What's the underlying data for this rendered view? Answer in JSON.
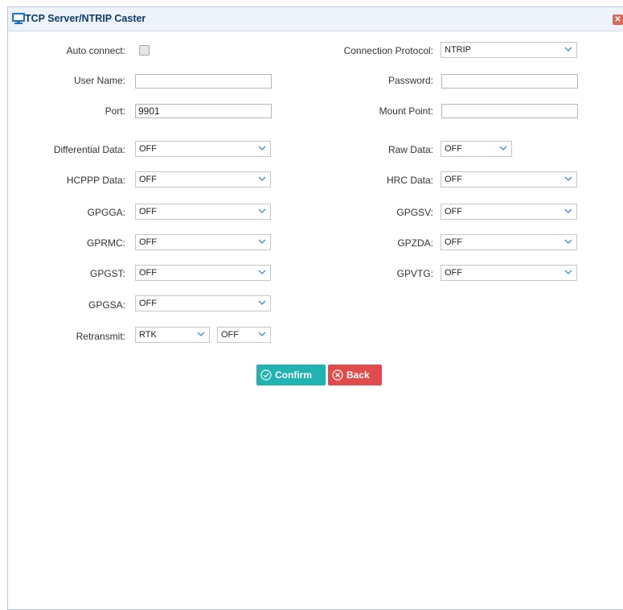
{
  "dialog": {
    "title": "TCP Server/NTRIP Caster",
    "close_icon_glyph": "✕"
  },
  "form": {
    "auto_connect_label": "Auto connect:",
    "auto_connect_checked": false,
    "connection_protocol_label": "Connection Protocol:",
    "connection_protocol_value": "NTRIP",
    "user_name_label": "User Name:",
    "user_name_value": "",
    "password_label": "Password:",
    "password_value": "",
    "port_label": "Port:",
    "port_value": "9901",
    "mount_point_label": "Mount Point:",
    "mount_point_value": "",
    "differential_data_label": "Differential Data:",
    "differential_data_value": "OFF",
    "raw_data_label": "Raw Data:",
    "raw_data_value": "OFF",
    "hcppp_data_label": "HCPPP Data:",
    "hcppp_data_value": "OFF",
    "hrc_data_label": "HRC Data:",
    "hrc_data_value": "OFF",
    "gpgga_label": "GPGGA:",
    "gpgga_value": "OFF",
    "gpgsv_label": "GPGSV:",
    "gpgsv_value": "OFF",
    "gprmc_label": "GPRMC:",
    "gprmc_value": "OFF",
    "gpzda_label": "GPZDA:",
    "gpzda_value": "OFF",
    "gpgst_label": "GPGST:",
    "gpgst_value": "OFF",
    "gpvtg_label": "GPVTG:",
    "gpvtg_value": "OFF",
    "gpgsa_label": "GPGSA:",
    "gpgsa_value": "OFF",
    "retransmit_label": "Retransmit:",
    "retransmit_type_value": "RTK",
    "retransmit_state_value": "OFF"
  },
  "buttons": {
    "confirm_label": "Confirm",
    "back_label": "Back"
  },
  "colors": {
    "confirm": "#21b2b2",
    "back": "#e04b4b",
    "title_text": "#0e3a6e",
    "title_bar": "#eef3fa"
  }
}
